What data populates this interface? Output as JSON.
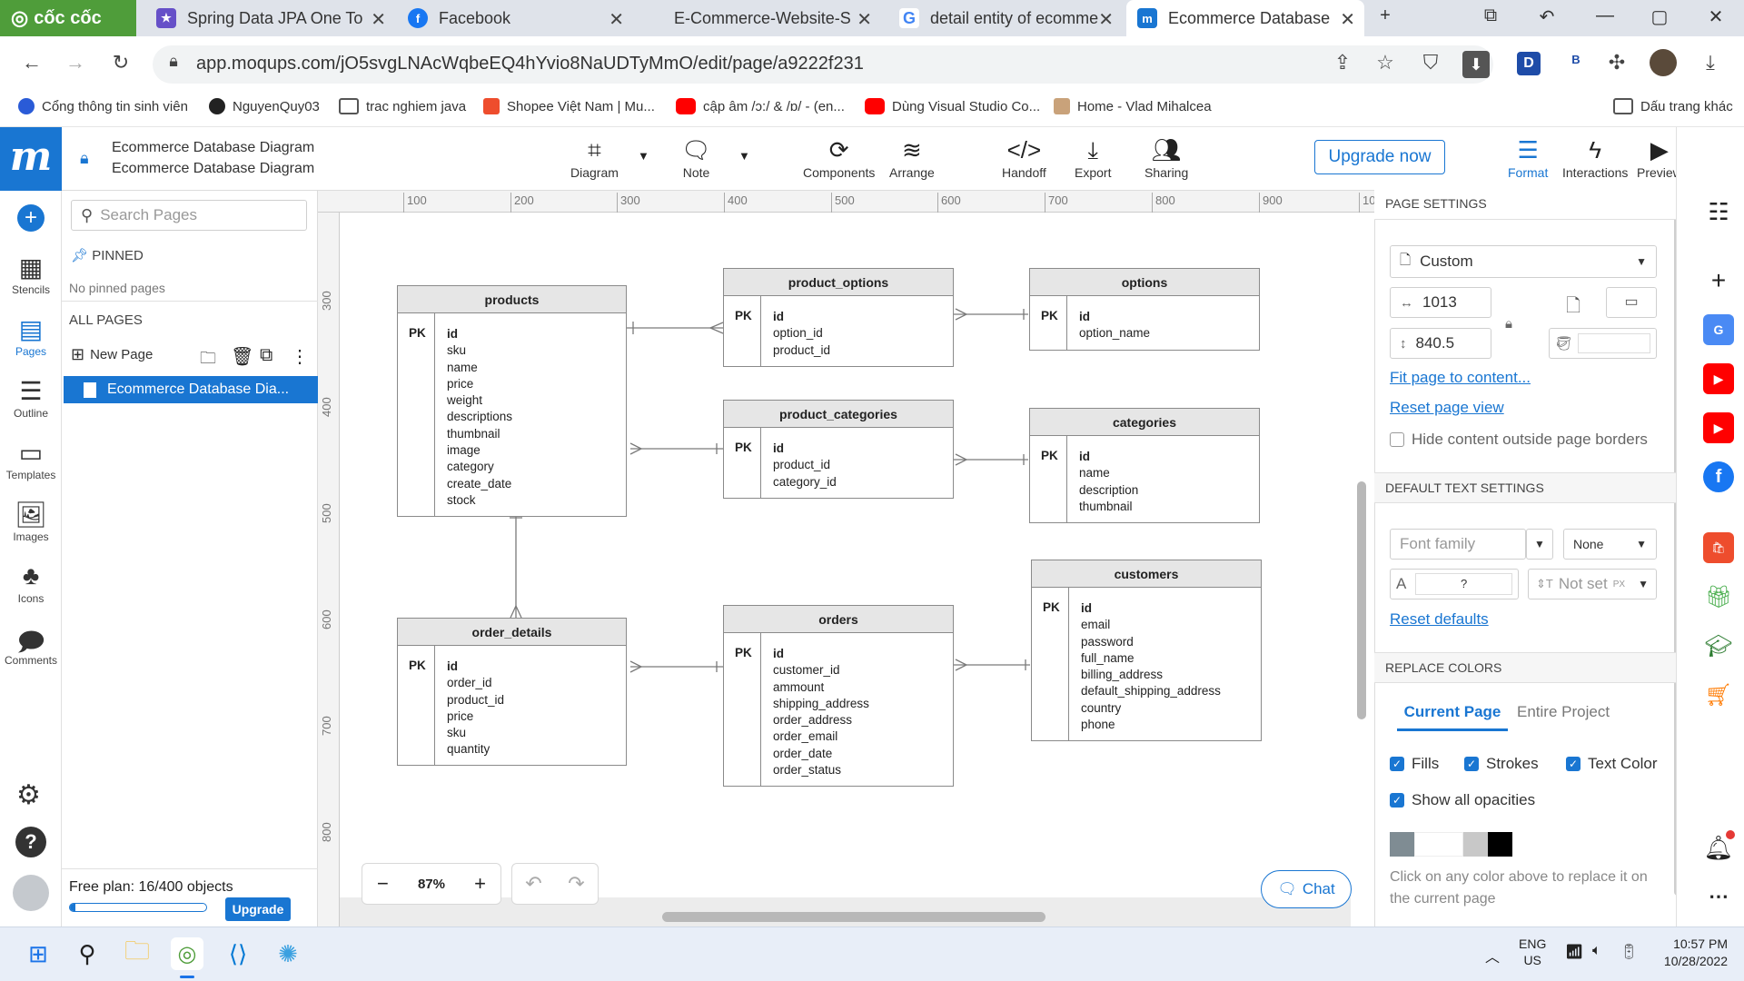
{
  "browser": {
    "tabs": [
      {
        "title": "Cốc Cốc",
        "icon": "coccoc-icon",
        "color": "#4f9d3a"
      },
      {
        "title": "Spring Data JPA One To",
        "icon": "star-favicon",
        "color": "#6650c8"
      },
      {
        "title": "Facebook",
        "icon": "facebook-icon",
        "color": "#1877f2"
      },
      {
        "title": "E-Commerce-Website-S",
        "icon": "github-icon",
        "color": "#222222"
      },
      {
        "title": "detail entity of ecomme",
        "icon": "google-icon",
        "color": "#4285f4"
      },
      {
        "title": "Ecommerce Database D",
        "icon": "moqups-icon",
        "color": "#1976d2"
      }
    ],
    "url": "app.moqups.com/jO5svgLNAcWqbeEQ4hYvio8NaUDTyMmO/edit/page/a9222f231",
    "bookmarks": [
      {
        "label": "Cổng thông tin sinh viên",
        "icon": "university-icon"
      },
      {
        "label": "NguyenQuy03",
        "icon": "github-icon"
      },
      {
        "label": "trac nghiem java",
        "icon": "folder-icon"
      },
      {
        "label": "Shopee Việt Nam | Mu...",
        "icon": "shopee-icon"
      },
      {
        "label": "cập âm /ɔ:/ & /ɒ/ - (en...",
        "icon": "youtube-icon"
      },
      {
        "label": "Dùng Visual Studio Co...",
        "icon": "youtube-icon"
      },
      {
        "label": "Home - Vlad Mihalcea",
        "icon": "person-icon"
      }
    ],
    "bookmarks_other": "Dấu trang khác"
  },
  "app": {
    "doc_title": "Ecommerce Database Diagram",
    "doc_subtitle": "Ecommerce Database Diagram",
    "toolbar": {
      "diagram": "Diagram",
      "note": "Note",
      "components": "Components",
      "arrange": "Arrange",
      "handoff": "Handoff",
      "export": "Export",
      "sharing": "Sharing",
      "upgrade_now": "Upgrade now",
      "format": "Format",
      "interactions": "Interactions",
      "preview": "Preview"
    },
    "rail": {
      "stencils": "Stencils",
      "pages": "Pages",
      "outline": "Outline",
      "templates": "Templates",
      "images": "Images",
      "icons": "Icons",
      "comments": "Comments"
    },
    "pages_panel": {
      "search_placeholder": "Search Pages",
      "pinned": "PINNED",
      "no_pinned": "No pinned pages",
      "all_pages": "ALL PAGES",
      "new_page": "New Page",
      "current_page": "Ecommerce Database Dia...",
      "plan_text": "Free plan: 16/400 objects",
      "plan_fraction": 0.04,
      "upgrade": "Upgrade"
    },
    "ruler": {
      "h": [
        "100",
        "200",
        "300",
        "400",
        "500",
        "600",
        "700",
        "800",
        "900",
        "10"
      ],
      "v": [
        "300",
        "400",
        "500",
        "600",
        "700",
        "800"
      ]
    },
    "zoom": {
      "minus": "−",
      "value": "87%",
      "plus": "+"
    },
    "chat": "Chat",
    "diagram": {
      "pk_label": "PK",
      "tables": {
        "products": {
          "name": "products",
          "fields": [
            "id",
            "sku",
            "name",
            "price",
            "weight",
            "descriptions",
            "thumbnail",
            "image",
            "category",
            "create_date",
            "stock"
          ]
        },
        "product_options": {
          "name": "product_options",
          "fields": [
            "id",
            "option_id",
            "product_id"
          ]
        },
        "options": {
          "name": "options",
          "fields": [
            "id",
            "option_name"
          ]
        },
        "product_categories": {
          "name": "product_categories",
          "fields": [
            "id",
            "product_id",
            "category_id"
          ]
        },
        "categories": {
          "name": "categories",
          "fields": [
            "id",
            "name",
            "description",
            "thumbnail"
          ]
        },
        "customers": {
          "name": "customers",
          "fields": [
            "id",
            "email",
            "password",
            "full_name",
            "billing_address",
            "default_shipping_address",
            "country",
            "phone"
          ]
        },
        "order_details": {
          "name": "order_details",
          "fields": [
            "id",
            "order_id",
            "product_id",
            "price",
            "sku",
            "quantity"
          ]
        },
        "orders": {
          "name": "orders",
          "fields": [
            "id",
            "customer_id",
            "ammount",
            "shipping_address",
            "order_address",
            "order_email",
            "order_date",
            "order_status"
          ]
        }
      }
    },
    "right_panel": {
      "page_settings": "PAGE SETTINGS",
      "size_preset": "Custom",
      "width": "1013",
      "height": "840.5",
      "fit_page": "Fit page to content...",
      "reset_view": "Reset page view",
      "hide_outside": "Hide content outside page borders",
      "default_text": "DEFAULT TEXT SETTINGS",
      "font_family": "Font family",
      "font_style": "None",
      "font_size": "?",
      "not_set": "Not set",
      "px": "PX",
      "reset_defaults": "Reset defaults",
      "replace_colors": "REPLACE COLORS",
      "tab_current": "Current Page",
      "tab_entire": "Entire Project",
      "fills": "Fills",
      "strokes": "Strokes",
      "text_color": "Text Color",
      "show_opacities": "Show all opacities",
      "swatches": [
        "#7f8c93",
        "#ffffff",
        "#c8c8c8",
        "#000000"
      ],
      "hint": "Click on any color above to replace it on the current page"
    }
  },
  "taskbar": {
    "lang": "ENG",
    "region": "US",
    "time": "10:57 PM",
    "date": "10/28/2022"
  }
}
